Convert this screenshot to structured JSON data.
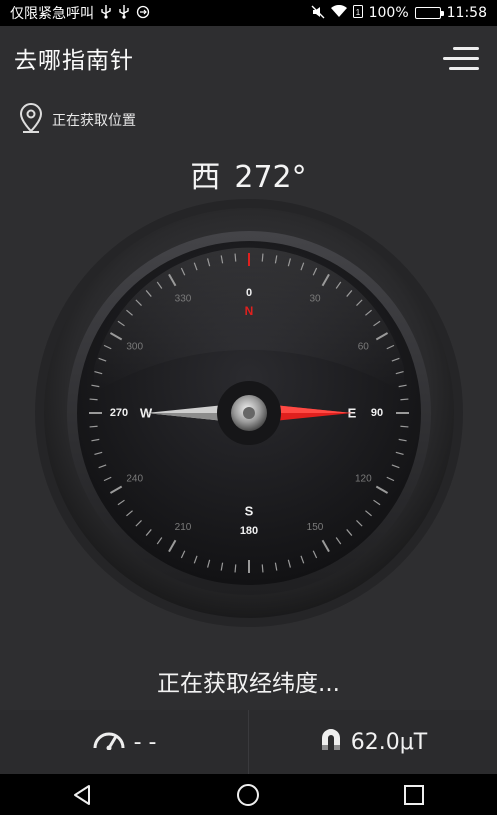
{
  "status_bar": {
    "carrier_text": "仅限紧急呼叫",
    "battery_percent": "100%",
    "battery_level": 1.0,
    "time": "11:58",
    "battery_color": "#37d13c"
  },
  "app": {
    "title": "去哪指南针",
    "location_text": "正在获取位置",
    "heading_direction": "西",
    "heading_degrees": "272°",
    "heading_value": 272,
    "latlon_text": "正在获取经纬度...",
    "speed_value": "- -",
    "magnetic_value": "62.0μT"
  },
  "compass": {
    "cardinal": {
      "N": "N",
      "E": "E",
      "S": "S",
      "W": "W"
    },
    "degree_labels": [
      "0",
      "30",
      "60",
      "90",
      "120",
      "150",
      "180",
      "210",
      "240",
      "270",
      "300",
      "330"
    ],
    "north_color": "#e0201e",
    "needle_red": "#e0201e"
  },
  "icons": {
    "location": "map-pin-icon",
    "menu": "menu-icon",
    "speed": "speedometer-icon",
    "magnet": "magnet-icon"
  },
  "nav": {
    "back": "back-icon",
    "home": "home-icon",
    "recents": "recents-icon"
  }
}
